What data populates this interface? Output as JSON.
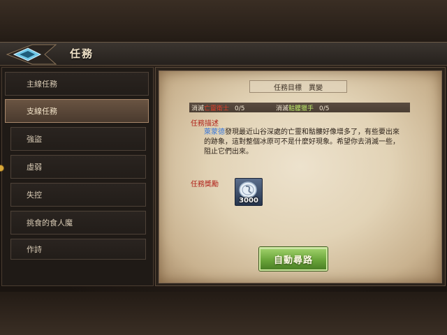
{
  "header": {
    "title": "任務"
  },
  "sidebar": {
    "items": [
      {
        "label": "主線任務"
      },
      {
        "label": "支線任務"
      },
      {
        "label": "強盜"
      },
      {
        "label": "虛弱"
      },
      {
        "label": "失控"
      },
      {
        "label": "挑食的食人魔"
      },
      {
        "label": "作詩"
      }
    ]
  },
  "quest": {
    "goal_title": "任務目標　異變",
    "targets": [
      {
        "prefix": "消滅",
        "name": "亡靈衛士",
        "progress": "0/5"
      },
      {
        "prefix": "消滅",
        "name": "骷髏獵手",
        "progress": "0/5"
      }
    ],
    "description_title": "任務描述",
    "description_npc": "萊蒙德",
    "description_text": "發現最近山谷深處的亡靈和骷髏好像增多了，有些要出來的跡象，這對整個冰原可不是什麼好現象。希望你去消滅一些，阻止它們出來。",
    "reward_title": "任務獎勵",
    "reward_count": "3000"
  },
  "buttons": {
    "auto_path": "自動尋路"
  },
  "icons": {
    "back": "back-arrow-icon",
    "reward": "silver-coin-icon"
  }
}
